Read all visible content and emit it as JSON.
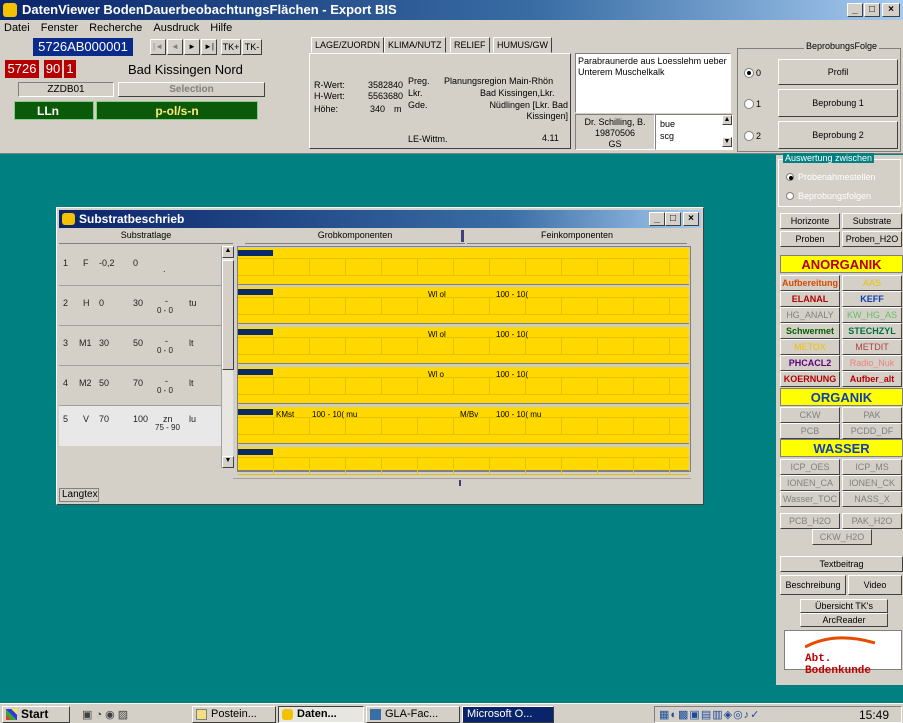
{
  "window": {
    "title": "DatenViewer BodenDauerbeobachtungsFlächen - Export BIS",
    "min": "_",
    "max": "□",
    "close": "×"
  },
  "menu": [
    "Datei",
    "Fenster",
    "Recherche",
    "Ausdruck",
    "Hilfe"
  ],
  "site": {
    "id": "5726AB000001",
    "num1": "5726",
    "num2": "90",
    "num3": "1",
    "name": "Bad Kissingen Nord",
    "code": "ZZDB01",
    "selection": "Selection",
    "llg": "LLn",
    "soil": "p-ol/s-n"
  },
  "nav": {
    "first": "|◄",
    "prev": "◄",
    "next": "►",
    "last": "►|",
    "tkplus": "TK+",
    "tkminus": "TK-"
  },
  "tabs": [
    "LAGE/ZUORDN",
    "KLIMA/NUTZ",
    "RELIEF",
    "HUMUS/GW"
  ],
  "lage": {
    "rwert_label": "R-Wert:",
    "rwert": "3582840",
    "hwert_label": "H-Wert:",
    "hwert": "5563680",
    "hoehe_label": "Höhe:",
    "hoehe": "340",
    "hoehe_unit": "m",
    "preg_label": "Preg.",
    "preg": "Planungsregion Main-Rhön",
    "lkr_label": "Lkr.",
    "lkr": "Bad Kissingen,Lkr.",
    "gde_label": "Gde.",
    "gde": "Nüdlingen [Lkr. Bad Kissingen]",
    "le_label": "LE-Wittm.",
    "le": "4.11"
  },
  "description": "Parabraunerde aus Loesslehm ueber Unterem Muschelkalk",
  "author": {
    "name": "Dr. Schilling, B.",
    "date": "19870506",
    "code": "GS",
    "list": [
      "bue",
      "scg"
    ]
  },
  "beprobung": {
    "title": "BeprobungsFolge",
    "options": [
      {
        "label": "0",
        "text": "Profil"
      },
      {
        "label": "1",
        "text": "Beprobung 1"
      },
      {
        "label": "2",
        "text": "Beprobung 2"
      }
    ]
  },
  "right": {
    "auswertung_title": "Auswertung zwischen",
    "radio1": "Probenahmestellen",
    "radio2": "Beprobungsfolgen",
    "btns_top": [
      "Horizonte",
      "Substrate",
      "Proben",
      "Proben_H2O"
    ],
    "anorganik": "ANORGANIK",
    "anorg_btns": [
      "Aufbereitung",
      "AAS",
      "ELANAL",
      "KEFF",
      "HG_ANALY",
      "KW_HG_AS",
      "Schwermet",
      "STECHZYL",
      "METOX",
      "METDIT",
      "PHCACL2",
      "Radio_Nuk",
      "KOERNUNG",
      "Aufber_alt"
    ],
    "organik": "ORGANIK",
    "org_btns": [
      "CKW",
      "PAK",
      "PCB",
      "PCDD_DF"
    ],
    "wasser": "WASSER",
    "wasser_btns": [
      "ICP_OES",
      "ICP_MS",
      "IONEN_CA",
      "IONEN_CK",
      "Wasser_TOC",
      "NASS_X"
    ],
    "h2o_btns": [
      "PCB_H2O",
      "PAK_H2O",
      "CKW_H2O"
    ],
    "textbeitrag": "Textbeitrag",
    "beschreibung": "Beschreibung",
    "video": "Video",
    "uebersicht": "Übersicht TK's",
    "arcreader": "ArcReader",
    "logo": "Abt. Bodenkunde"
  },
  "substrat": {
    "title": "Substratbeschrieb",
    "col_left": "Substratlage",
    "col_grob": "Grobkomponenten",
    "col_fein": "Feinkomponenten",
    "rows": [
      {
        "n": "1",
        "h": "F",
        "a": "-0,2",
        "b": "0",
        "c": "",
        "d": ".",
        "e": "",
        "grob": "",
        "grob2": "",
        "fein1": "",
        "fein2": ""
      },
      {
        "n": "2",
        "h": "H",
        "a": "0",
        "b": "30",
        "c": "-",
        "d": "0 - 0",
        "e": "tu",
        "grob": "",
        "grob2": "",
        "fein1": "Wl ol",
        "fein2": "100 - 10("
      },
      {
        "n": "3",
        "h": "M1",
        "a": "30",
        "b": "50",
        "c": "-",
        "d": "0 - 0",
        "e": "lt",
        "grob": "",
        "grob2": "",
        "fein1": "Wl ol",
        "fein2": "100 - 10("
      },
      {
        "n": "4",
        "h": "M2",
        "a": "50",
        "b": "70",
        "c": "-",
        "d": "0 - 0",
        "e": "lt",
        "grob": "",
        "grob2": "",
        "fein1": "Wl o",
        "fein2": "100 - 10("
      },
      {
        "n": "5",
        "h": "V",
        "a": "70",
        "b": "100",
        "c": "zn",
        "d": "75 - 90",
        "e": "lu",
        "grob": "KMst",
        "grob2": "100 - 10( mu",
        "fein1": "M/Bv",
        "fein2": "100 - 10( mu"
      }
    ],
    "langtext": "Langtex"
  },
  "taskbar": {
    "start": "Start",
    "items": [
      "Postein...",
      "Daten...",
      "GLA-Fac...",
      "Microsoft O..."
    ],
    "clock": "15:49"
  },
  "colors": {
    "teal": "#008080",
    "gray": "#d4d0c8",
    "yellow": "#ffd800",
    "navy": "#0a2a8c"
  }
}
